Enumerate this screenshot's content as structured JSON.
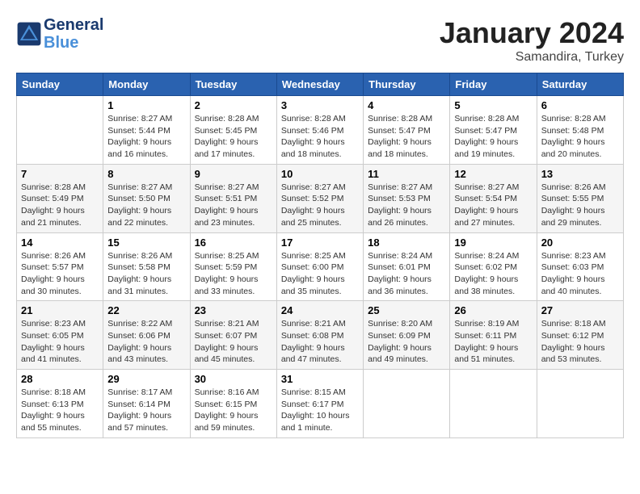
{
  "header": {
    "logo_line1": "General",
    "logo_line2": "Blue",
    "month_title": "January 2024",
    "location": "Samandira, Turkey"
  },
  "weekdays": [
    "Sunday",
    "Monday",
    "Tuesday",
    "Wednesday",
    "Thursday",
    "Friday",
    "Saturday"
  ],
  "weeks": [
    [
      {
        "day": "",
        "info": ""
      },
      {
        "day": "1",
        "info": "Sunrise: 8:27 AM\nSunset: 5:44 PM\nDaylight: 9 hours\nand 16 minutes."
      },
      {
        "day": "2",
        "info": "Sunrise: 8:28 AM\nSunset: 5:45 PM\nDaylight: 9 hours\nand 17 minutes."
      },
      {
        "day": "3",
        "info": "Sunrise: 8:28 AM\nSunset: 5:46 PM\nDaylight: 9 hours\nand 18 minutes."
      },
      {
        "day": "4",
        "info": "Sunrise: 8:28 AM\nSunset: 5:47 PM\nDaylight: 9 hours\nand 18 minutes."
      },
      {
        "day": "5",
        "info": "Sunrise: 8:28 AM\nSunset: 5:47 PM\nDaylight: 9 hours\nand 19 minutes."
      },
      {
        "day": "6",
        "info": "Sunrise: 8:28 AM\nSunset: 5:48 PM\nDaylight: 9 hours\nand 20 minutes."
      }
    ],
    [
      {
        "day": "7",
        "info": "Sunrise: 8:28 AM\nSunset: 5:49 PM\nDaylight: 9 hours\nand 21 minutes."
      },
      {
        "day": "8",
        "info": "Sunrise: 8:27 AM\nSunset: 5:50 PM\nDaylight: 9 hours\nand 22 minutes."
      },
      {
        "day": "9",
        "info": "Sunrise: 8:27 AM\nSunset: 5:51 PM\nDaylight: 9 hours\nand 23 minutes."
      },
      {
        "day": "10",
        "info": "Sunrise: 8:27 AM\nSunset: 5:52 PM\nDaylight: 9 hours\nand 25 minutes."
      },
      {
        "day": "11",
        "info": "Sunrise: 8:27 AM\nSunset: 5:53 PM\nDaylight: 9 hours\nand 26 minutes."
      },
      {
        "day": "12",
        "info": "Sunrise: 8:27 AM\nSunset: 5:54 PM\nDaylight: 9 hours\nand 27 minutes."
      },
      {
        "day": "13",
        "info": "Sunrise: 8:26 AM\nSunset: 5:55 PM\nDaylight: 9 hours\nand 29 minutes."
      }
    ],
    [
      {
        "day": "14",
        "info": "Sunrise: 8:26 AM\nSunset: 5:57 PM\nDaylight: 9 hours\nand 30 minutes."
      },
      {
        "day": "15",
        "info": "Sunrise: 8:26 AM\nSunset: 5:58 PM\nDaylight: 9 hours\nand 31 minutes."
      },
      {
        "day": "16",
        "info": "Sunrise: 8:25 AM\nSunset: 5:59 PM\nDaylight: 9 hours\nand 33 minutes."
      },
      {
        "day": "17",
        "info": "Sunrise: 8:25 AM\nSunset: 6:00 PM\nDaylight: 9 hours\nand 35 minutes."
      },
      {
        "day": "18",
        "info": "Sunrise: 8:24 AM\nSunset: 6:01 PM\nDaylight: 9 hours\nand 36 minutes."
      },
      {
        "day": "19",
        "info": "Sunrise: 8:24 AM\nSunset: 6:02 PM\nDaylight: 9 hours\nand 38 minutes."
      },
      {
        "day": "20",
        "info": "Sunrise: 8:23 AM\nSunset: 6:03 PM\nDaylight: 9 hours\nand 40 minutes."
      }
    ],
    [
      {
        "day": "21",
        "info": "Sunrise: 8:23 AM\nSunset: 6:05 PM\nDaylight: 9 hours\nand 41 minutes."
      },
      {
        "day": "22",
        "info": "Sunrise: 8:22 AM\nSunset: 6:06 PM\nDaylight: 9 hours\nand 43 minutes."
      },
      {
        "day": "23",
        "info": "Sunrise: 8:21 AM\nSunset: 6:07 PM\nDaylight: 9 hours\nand 45 minutes."
      },
      {
        "day": "24",
        "info": "Sunrise: 8:21 AM\nSunset: 6:08 PM\nDaylight: 9 hours\nand 47 minutes."
      },
      {
        "day": "25",
        "info": "Sunrise: 8:20 AM\nSunset: 6:09 PM\nDaylight: 9 hours\nand 49 minutes."
      },
      {
        "day": "26",
        "info": "Sunrise: 8:19 AM\nSunset: 6:11 PM\nDaylight: 9 hours\nand 51 minutes."
      },
      {
        "day": "27",
        "info": "Sunrise: 8:18 AM\nSunset: 6:12 PM\nDaylight: 9 hours\nand 53 minutes."
      }
    ],
    [
      {
        "day": "28",
        "info": "Sunrise: 8:18 AM\nSunset: 6:13 PM\nDaylight: 9 hours\nand 55 minutes."
      },
      {
        "day": "29",
        "info": "Sunrise: 8:17 AM\nSunset: 6:14 PM\nDaylight: 9 hours\nand 57 minutes."
      },
      {
        "day": "30",
        "info": "Sunrise: 8:16 AM\nSunset: 6:15 PM\nDaylight: 9 hours\nand 59 minutes."
      },
      {
        "day": "31",
        "info": "Sunrise: 8:15 AM\nSunset: 6:17 PM\nDaylight: 10 hours\nand 1 minute."
      },
      {
        "day": "",
        "info": ""
      },
      {
        "day": "",
        "info": ""
      },
      {
        "day": "",
        "info": ""
      }
    ]
  ]
}
